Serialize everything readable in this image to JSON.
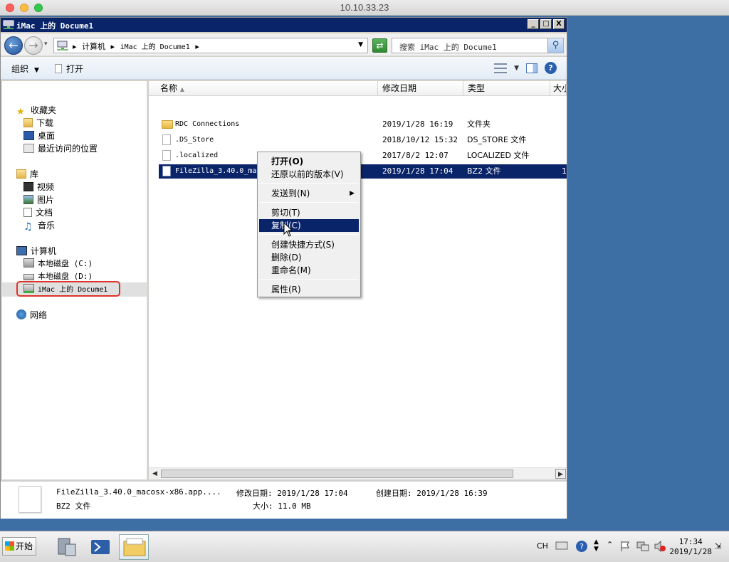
{
  "mac": {
    "title": "10.10.33.23"
  },
  "window": {
    "title": "iMac 上的 Docume1",
    "controls": {
      "minimize": "_",
      "maximize": "□",
      "close": "X"
    }
  },
  "address": {
    "crumbs": [
      "计算机",
      "iMac 上的 Docume1"
    ],
    "search_placeholder": "搜索 iMac 上的 Docume1"
  },
  "toolbar": {
    "organize": "组织",
    "open": "打开"
  },
  "nav": {
    "favorites": "收藏夹",
    "downloads": "下载",
    "desktop": "桌面",
    "recent": "最近访问的位置",
    "libraries": "库",
    "videos": "视频",
    "pictures": "图片",
    "documents": "文档",
    "music": "音乐",
    "computer": "计算机",
    "disk_c": "本地磁盘 (C:)",
    "disk_d": "本地磁盘 (D:)",
    "imac": "iMac 上的 Docume1",
    "network": "网络"
  },
  "columns": {
    "name": "名称",
    "date": "修改日期",
    "type": "类型",
    "size": "大小"
  },
  "files": [
    {
      "name": "RDC Connections",
      "date": "2019/1/28 16:19",
      "type": "文件夹",
      "kind": "folder"
    },
    {
      "name": ".DS_Store",
      "date": "2018/10/12 15:32",
      "type": "DS_STORE 文件",
      "kind": "file"
    },
    {
      "name": ".localized",
      "date": "2017/8/2 12:07",
      "type": "LOCALIZED 文件",
      "kind": "file"
    },
    {
      "name": "FileZilla_3.40.0_ma",
      "date": "2019/1/28 17:04",
      "type": "BZ2 文件",
      "kind": "file",
      "size": "1"
    }
  ],
  "context_menu": {
    "open": "打开(O)",
    "restore": "还原以前的版本(V)",
    "sendto": "发送到(N)",
    "cut": "剪切(T)",
    "copy": "复制(C)",
    "shortcut": "创建快捷方式(S)",
    "delete": "删除(D)",
    "rename": "重命名(M)",
    "properties": "属性(R)"
  },
  "details": {
    "filename": "FileZilla_3.40.0_macosx-x86.app....",
    "filetype": "BZ2 文件",
    "modified": "修改日期: 2019/1/28 17:04",
    "created": "创建日期: 2019/1/28 16:39",
    "size": "大小: 11.0 MB"
  },
  "taskbar": {
    "start": "开始",
    "lang": "CH",
    "time": "17:34",
    "date": "2019/1/28"
  }
}
